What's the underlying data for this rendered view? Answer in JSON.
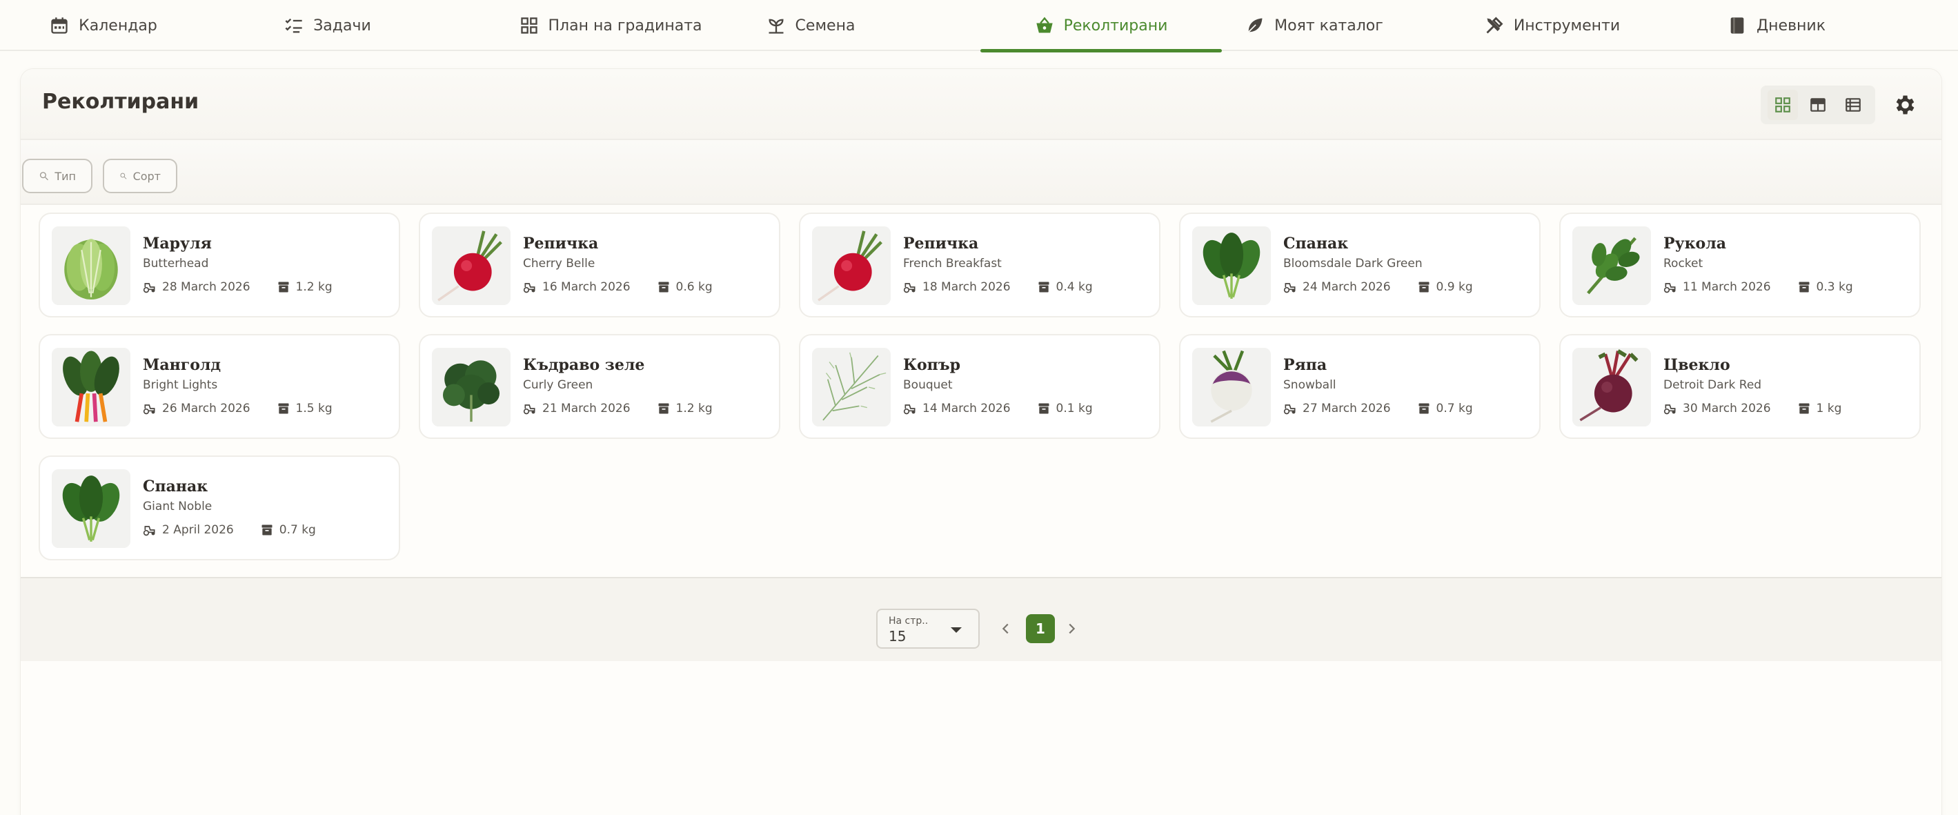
{
  "nav": {
    "items": [
      {
        "label": "Календар",
        "icon": "calendar-icon"
      },
      {
        "label": "Задачи",
        "icon": "checklist-icon"
      },
      {
        "label": "План на градината",
        "icon": "grid-plan-icon"
      },
      {
        "label": "Семена",
        "icon": "sprout-icon"
      },
      {
        "label": "Реколтирани",
        "icon": "basket-icon",
        "active": true
      },
      {
        "label": "Моят каталог",
        "icon": "leaf-icon"
      },
      {
        "label": "Инструменти",
        "icon": "tools-icon"
      },
      {
        "label": "Дневник",
        "icon": "book-icon"
      }
    ]
  },
  "page": {
    "title": "Реколтирани"
  },
  "view_modes": [
    "grid-view-icon",
    "table-view-icon",
    "list-view-icon"
  ],
  "active_view": "grid",
  "filters": {
    "type_placeholder": "Тип",
    "variety_placeholder": "Сорт"
  },
  "harvests": [
    {
      "name": "Маруля",
      "variety": "Butterhead",
      "date": "28 March 2026",
      "weight": "1.2 kg",
      "image": "lettuce"
    },
    {
      "name": "Репичка",
      "variety": "Cherry Belle",
      "date": "16 March 2026",
      "weight": "0.6 kg",
      "image": "radish"
    },
    {
      "name": "Репичка",
      "variety": "French Breakfast",
      "date": "18 March 2026",
      "weight": "0.4 kg",
      "image": "radish"
    },
    {
      "name": "Спанак",
      "variety": "Bloomsdale Dark Green",
      "date": "24 March 2026",
      "weight": "0.9 kg",
      "image": "spinach"
    },
    {
      "name": "Рукола",
      "variety": "Rocket",
      "date": "11 March 2026",
      "weight": "0.3 kg",
      "image": "arugula"
    },
    {
      "name": "Манголд",
      "variety": "Bright Lights",
      "date": "26 March 2026",
      "weight": "1.5 kg",
      "image": "chard"
    },
    {
      "name": "Къдраво зеле",
      "variety": "Curly Green",
      "date": "21 March 2026",
      "weight": "1.2 kg",
      "image": "kale"
    },
    {
      "name": "Копър",
      "variety": "Bouquet",
      "date": "14 March 2026",
      "weight": "0.1 kg",
      "image": "dill"
    },
    {
      "name": "Ряпа",
      "variety": "Snowball",
      "date": "27 March 2026",
      "weight": "0.7 kg",
      "image": "turnip"
    },
    {
      "name": "Цвекло",
      "variety": "Detroit Dark Red",
      "date": "30 March 2026",
      "weight": "1 kg",
      "image": "beet"
    },
    {
      "name": "Спанак",
      "variety": "Giant Noble",
      "date": "2 April 2026",
      "weight": "0.7 kg",
      "image": "spinach"
    }
  ],
  "pagination": {
    "per_page_label": "На стр..",
    "per_page_value": "15",
    "current_page": "1"
  },
  "colors": {
    "accent": "#4b8a2e",
    "page_button": "#4b7f2a",
    "text": "#3d3a35"
  }
}
